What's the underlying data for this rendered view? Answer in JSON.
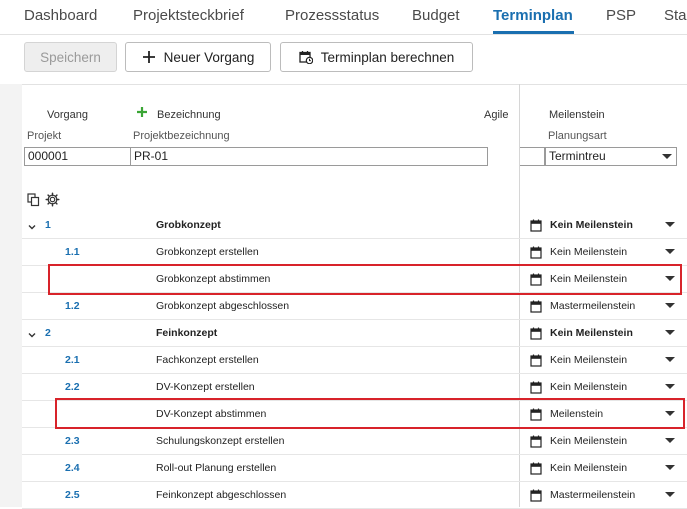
{
  "tabs": [
    {
      "label": "Dashboard"
    },
    {
      "label": "Projektsteckbrief"
    },
    {
      "label": "Prozessstatus"
    },
    {
      "label": "Budget"
    },
    {
      "label": "Terminplan"
    },
    {
      "label": "PSP"
    },
    {
      "label": "Sta"
    }
  ],
  "active_tab": "Terminplan",
  "toolbar": {
    "save_label": "Speichern",
    "new_task_label": "Neuer Vorgang",
    "calc_label": "Terminplan berechnen"
  },
  "header": {
    "vorgang": "Vorgang",
    "bezeichnung": "Bezeichnung",
    "agile": "Agile",
    "meilenstein": "Meilenstein"
  },
  "project": {
    "projekt_label": "Projekt",
    "projekt_value": "000001",
    "bez_label": "Projektbezeichnung",
    "bez_value": "PR-01",
    "planungsart_label": "Planungsart",
    "planungsart_value": "Termintreu"
  },
  "rows": [
    {
      "num": "1",
      "name": "Grobkonzept",
      "milestone": "Kein Meilenstein",
      "group": true
    },
    {
      "num": "1.1",
      "name": "Grobkonzept erstellen",
      "milestone": "Kein Meilenstein",
      "group": false
    },
    {
      "num": "",
      "name": "Grobkonzept abstimmen",
      "milestone": "Kein Meilenstein",
      "group": false
    },
    {
      "num": "1.2",
      "name": "Grobkonzept abgeschlossen",
      "milestone": "Mastermeilenstein",
      "group": false
    },
    {
      "num": "2",
      "name": "Feinkonzept",
      "milestone": "Kein Meilenstein",
      "group": true
    },
    {
      "num": "2.1",
      "name": "Fachkonzept erstellen",
      "milestone": "Kein Meilenstein",
      "group": false
    },
    {
      "num": "2.2",
      "name": "DV-Konzept erstellen",
      "milestone": "Kein Meilenstein",
      "group": false
    },
    {
      "num": "",
      "name": "DV-Konzept abstimmen",
      "milestone": "Meilenstein",
      "group": false
    },
    {
      "num": "2.3",
      "name": "Schulungskonzept erstellen",
      "milestone": "Kein Meilenstein",
      "group": false
    },
    {
      "num": "2.4",
      "name": "Roll-out Planung erstellen",
      "milestone": "Kein Meilenstein",
      "group": false
    },
    {
      "num": "2.5",
      "name": "Feinkonzept abgeschlossen",
      "milestone": "Mastermeilenstein",
      "group": false
    }
  ],
  "colors": {
    "accent": "#1a6fb0",
    "highlight": "#d8232a",
    "add_icon": "#3aa535"
  }
}
